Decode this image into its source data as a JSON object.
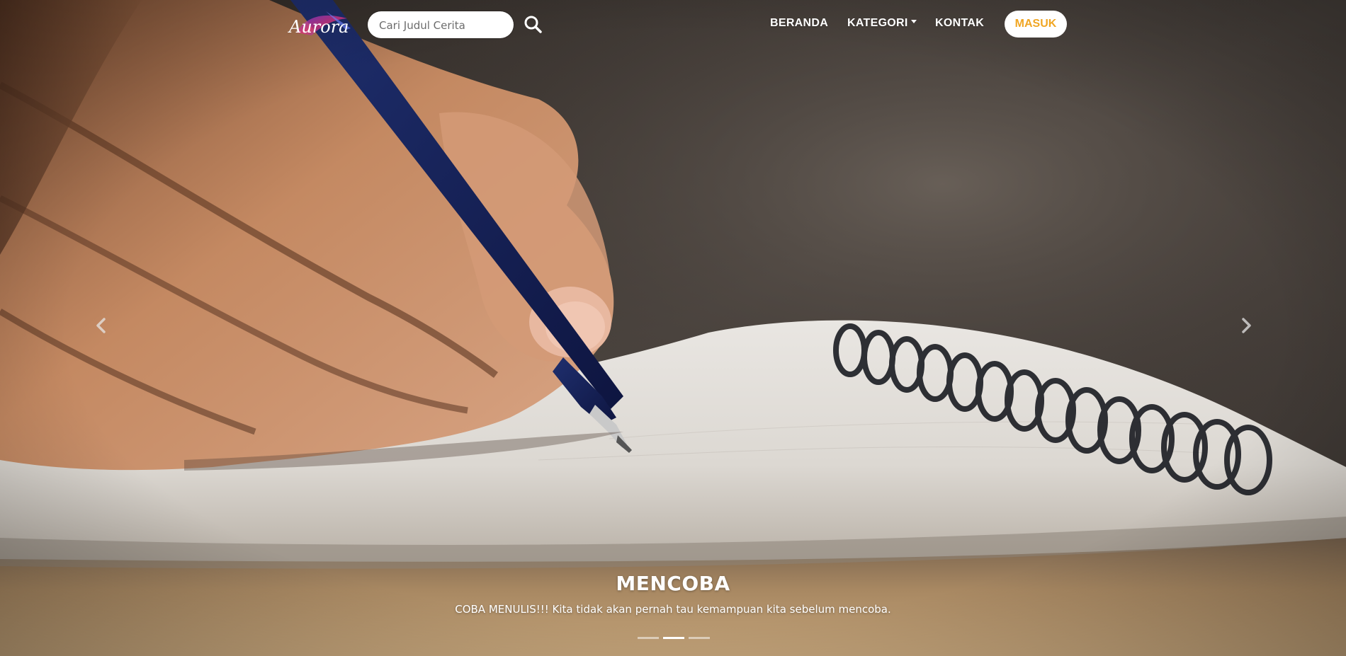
{
  "brand": {
    "logo_text": "Aurora"
  },
  "search": {
    "placeholder": "Cari Judul Cerita",
    "value": ""
  },
  "nav": {
    "items": [
      {
        "label": "BERANDA"
      },
      {
        "label": "KATEGORI",
        "has_dropdown": true
      },
      {
        "label": "KONTAK"
      }
    ],
    "login_label": "MASUK"
  },
  "carousel": {
    "slide": {
      "title": "MENCOBA",
      "text": "COBA MENULIS!!! Kita tidak akan pernah tau kemampuan kita sebelum mencoba."
    },
    "indicator_count": 3,
    "active_index": 1,
    "prev_icon": "chevron-left-icon",
    "next_icon": "chevron-right-icon"
  },
  "colors": {
    "login_text": "#f0a623",
    "nav_text": "#ffffff"
  }
}
